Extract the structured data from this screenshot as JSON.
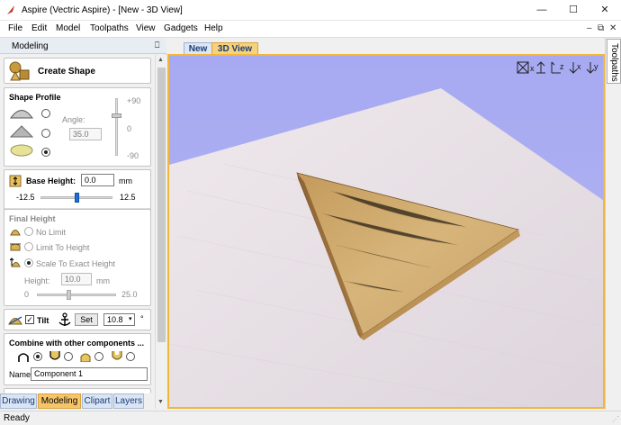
{
  "window": {
    "title": "Aspire (Vectric Aspire) - [New - 3D View]",
    "controls": [
      "—",
      "☐",
      "✕"
    ]
  },
  "menu": [
    "File",
    "Edit",
    "Model",
    "Toolpaths",
    "View",
    "Gadgets",
    "Help"
  ],
  "mdi_controls": [
    "–",
    "⧉",
    "✕"
  ],
  "panel": {
    "title": "Modeling",
    "pin": "📌",
    "create_shape": "Create Shape",
    "shape_profile": {
      "title": "Shape Profile",
      "angle_label": "Angle:",
      "angle_value": "35.0",
      "angle_scale": [
        "+90",
        "0",
        "-90"
      ],
      "selected_index": 2
    },
    "base_height": {
      "label": "Base Height:",
      "value": "0.0",
      "unit": "mm",
      "min": "-12.5",
      "max": "12.5",
      "slider_position": 0.5
    },
    "final_height": {
      "title": "Final Height",
      "options": [
        "No Limit",
        "Limit To Height",
        "Scale To Exact Height"
      ],
      "height_label": "Height:",
      "height_value": "10.0",
      "unit": "mm",
      "min": "0",
      "max": "25.0",
      "slider_position": 0.4
    },
    "tilt": {
      "label": "Tilt",
      "checked": true,
      "set_label": "Set",
      "value": "10.8",
      "degree": "°"
    },
    "combine": {
      "title": "Combine with other components ...",
      "selected_index": 0,
      "name_label": "Name",
      "name_value": "Component 1"
    },
    "bottom_tabs": [
      "Drawing",
      "Modeling",
      "Clipart",
      "Layers"
    ],
    "active_bottom_tab": "Modeling"
  },
  "doc_tabs": [
    "New",
    "3D View"
  ],
  "active_doc_tab": "3D View",
  "view_tools": [
    "iso",
    "x",
    "z",
    "x",
    "y"
  ],
  "right_tab": "Toolpaths",
  "status": "Ready",
  "colors": {
    "sky": "#a9a9f0",
    "wood_top": "#c9a36a",
    "material": "#e7dfe4",
    "accent": "#f2b638"
  }
}
